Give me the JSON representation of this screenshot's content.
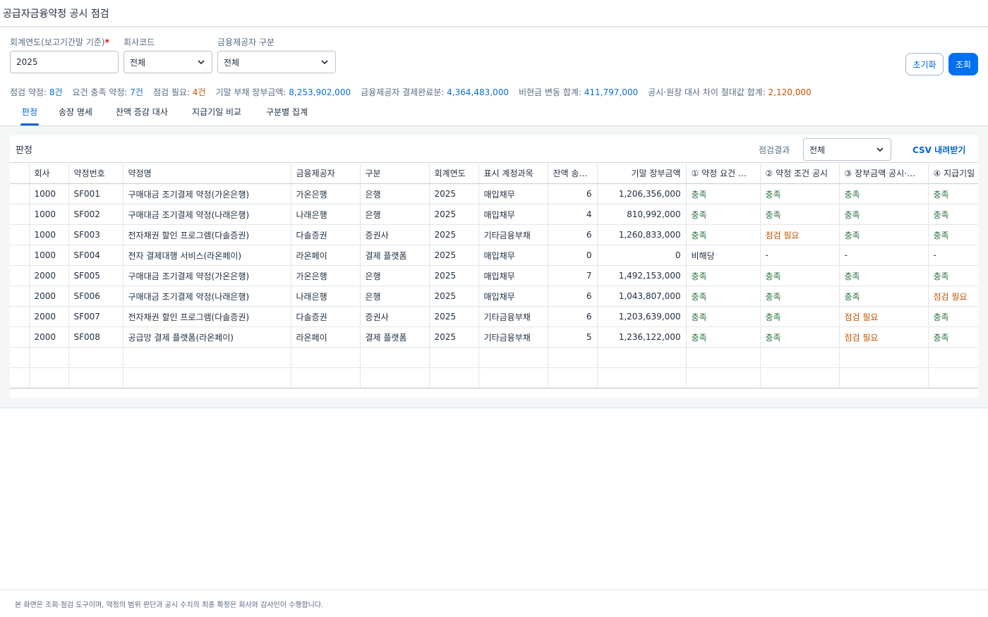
{
  "header": {
    "title": "공급자금융약정 공시 점검"
  },
  "filters": {
    "fiscal_year": {
      "label": "회계연도(보고기간말 기준)",
      "required_mark": "*",
      "value": "2025"
    },
    "company_code": {
      "label": "회사코드",
      "value": "전체"
    },
    "provider_type": {
      "label": "금융제공자 구분",
      "value": "전체"
    },
    "reset_label": "초기화",
    "search_label": "조회"
  },
  "summary": [
    {
      "label": "점검 약정: ",
      "value": "8건",
      "tone": "blue"
    },
    {
      "label": "요건 충족 약정: ",
      "value": "7건",
      "tone": "blue"
    },
    {
      "label": "점검 필요: ",
      "value": "4건",
      "tone": "orange"
    },
    {
      "label": "기말 부채 장부금액: ",
      "value": "8,253,902,000",
      "tone": "blue"
    },
    {
      "label": "금융제공자 결제완료분: ",
      "value": "4,364,483,000",
      "tone": "blue"
    },
    {
      "label": "비현금 변동 합계: ",
      "value": "411,797,000",
      "tone": "blue"
    },
    {
      "label": "공시·원장 대사 차이 절대값 합계: ",
      "value": "2,120,000",
      "tone": "orange"
    }
  ],
  "tabs": [
    {
      "label": "판정",
      "active": true
    },
    {
      "label": "송장 명세",
      "active": false
    },
    {
      "label": "잔액 증감 대사",
      "active": false
    },
    {
      "label": "지급기일 비교",
      "active": false
    },
    {
      "label": "구분별 집계",
      "active": false
    }
  ],
  "panel": {
    "title": "판정",
    "result_filter_label": "점검결과",
    "result_filter_value": "전체",
    "csv_label": "CSV 내려받기"
  },
  "table": {
    "columns": [
      "",
      "회사",
      "약정번호",
      "약정명",
      "금융제공자",
      "구분",
      "회계연도",
      "표시 계정과목",
      "잔액 송…",
      "기말 장부금액",
      "① 약정 요건 …",
      "② 약정 조건 공시",
      "③ 장부금액 공시·…",
      "④ 지급기일"
    ],
    "rows": [
      [
        "",
        "1000",
        "SF001",
        "구매대금 조기결제 약정(가온은행)",
        "가온은행",
        "은행",
        "2025",
        "매입채무",
        "6",
        "1,206,356,000",
        "충족",
        "충족",
        "충족",
        "충족"
      ],
      [
        "",
        "1000",
        "SF002",
        "구매대금 조기결제 약정(나래은행)",
        "나래은행",
        "은행",
        "2025",
        "매입채무",
        "4",
        "810,992,000",
        "충족",
        "충족",
        "충족",
        "충족"
      ],
      [
        "",
        "1000",
        "SF003",
        "전자채권 할인 프로그램(다솔증권)",
        "다솔증권",
        "증권사",
        "2025",
        "기타금융부채",
        "6",
        "1,260,833,000",
        "충족",
        "점검 필요",
        "충족",
        "충족"
      ],
      [
        "",
        "1000",
        "SF004",
        "전자 결제대행 서비스(라온페이)",
        "라온페이",
        "결제 플랫폼",
        "2025",
        "매입채무",
        "0",
        "0",
        "비해당",
        "-",
        "-",
        "-"
      ],
      [
        "",
        "2000",
        "SF005",
        "구매대금 조기결제 약정(가온은행)",
        "가온은행",
        "은행",
        "2025",
        "매입채무",
        "7",
        "1,492,153,000",
        "충족",
        "충족",
        "충족",
        "충족"
      ],
      [
        "",
        "2000",
        "SF006",
        "구매대금 조기결제 약정(나래은행)",
        "나래은행",
        "은행",
        "2025",
        "매입채무",
        "6",
        "1,043,807,000",
        "충족",
        "충족",
        "충족",
        "점검 필요"
      ],
      [
        "",
        "2000",
        "SF007",
        "전자채권 할인 프로그램(다솔증권)",
        "다솔증권",
        "증권사",
        "2025",
        "기타금융부채",
        "6",
        "1,203,639,000",
        "충족",
        "충족",
        "점검 필요",
        "충족"
      ],
      [
        "",
        "2000",
        "SF008",
        "공급망 결제 플랫폼(라온페이)",
        "라온페이",
        "결제 플랫폼",
        "2025",
        "기타금융부채",
        "5",
        "1,236,122,000",
        "충족",
        "충족",
        "점검 필요",
        "충족"
      ]
    ],
    "empty_rows": 2
  },
  "footer": {
    "note": "본 화면은 조회·점검 도구이며, 약정의 범위 판단과 공시 수치의 최종 확정은 회사와 감사인이 수행합니다."
  },
  "colors": {
    "accent": "#0070f2",
    "ok": "#256f3a",
    "warn": "#c35500",
    "value_blue": "#0a6ed1"
  }
}
